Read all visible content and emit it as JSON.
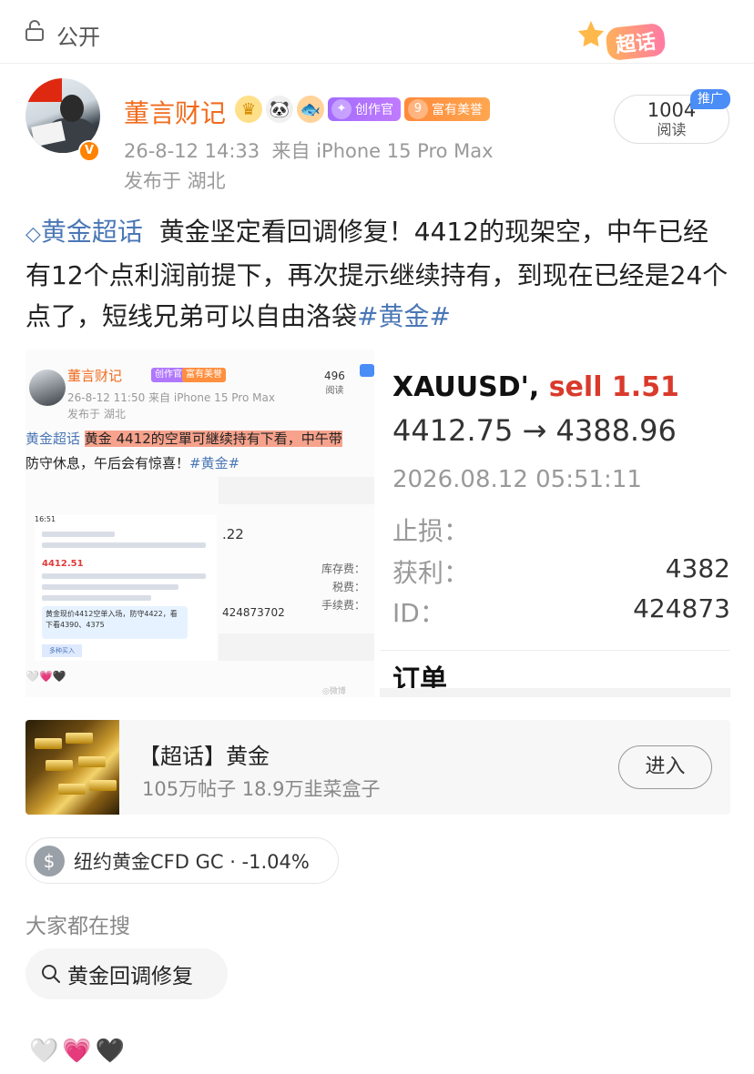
{
  "topbar": {
    "visibility_label": "公开",
    "badge_label": "超话"
  },
  "author": {
    "name": "董言财记",
    "badges": [
      {
        "name": "crown-badge",
        "glyph": "♛"
      },
      {
        "name": "panda-badge",
        "glyph": "🐼"
      },
      {
        "name": "fish-badge",
        "glyph": "🐟"
      }
    ],
    "creator_label": "创作官",
    "reputation_label": "富有美誉",
    "timestamp": "26-8-12 14:33",
    "source": "来自 iPhone 15 Pro Max",
    "location": "发布于 湖北",
    "read_count": "1004",
    "read_label": "阅读",
    "promo_tag": "推广"
  },
  "post": {
    "topic_link": "黄金超话",
    "body": "黄金坚定看回调修复！4412的现架空，中午已经有12个点利润前提下，再次提示继续持有，到现在已经是24个点了，短线兄弟可以自由洛袋",
    "hashtag": "#黄金#"
  },
  "image_left": {
    "name": "董言财记",
    "chip1": "创作官",
    "chip2": "富有美誉",
    "reads": "496",
    "reads_label": "阅读",
    "timestamp": "26-8-12 11:50 来自 iPhone 15 Pro Max",
    "location": "发布于 湖北",
    "topic": "黄金超话",
    "highlighted": "黄金 4412的空單可継续持有下看，中午带",
    "line2_prefix": "防守休息，午后会有惊喜！",
    "line2_tag": "#黄金#",
    "phone_time": "16:51",
    "phone_price": "4412.51",
    "phone_note": "黄金现价4412空单入场，防守4422，看下看4390、4375",
    "phone_btn": "多种买入",
    "value_22": ".22",
    "fee1": "库存费：",
    "fee2": "税费：",
    "fee3": "手续费：",
    "id_value": "424873702",
    "hearts": "🤍💗🖤"
  },
  "image_right": {
    "symbol": "XAUUSD',",
    "side": "sell 1.51",
    "price_move": "4412.75 → 4388.96",
    "time": "2026.08.12 05:51:11",
    "rows": [
      {
        "label": "止损：",
        "value": ""
      },
      {
        "label": "获利：",
        "value": "4382"
      },
      {
        "label": "ID：",
        "value": "424873"
      }
    ],
    "order_label": "订单"
  },
  "topic_card": {
    "title": "【超话】黄金",
    "stats": "105万帖子 18.9万韭菜盒子",
    "enter_label": "进入"
  },
  "stock_chip": {
    "icon": "$",
    "label": "纽约黄金CFD GC · -1.04%"
  },
  "search": {
    "heading": "大家都在搜",
    "query": "黄金回调修复"
  },
  "footer": {
    "hearts": "🤍💗🖤"
  },
  "colors": {
    "accent_blue": "#4a77b6",
    "name_orange": "#f26b1d",
    "sell_red": "#d93a2b"
  }
}
